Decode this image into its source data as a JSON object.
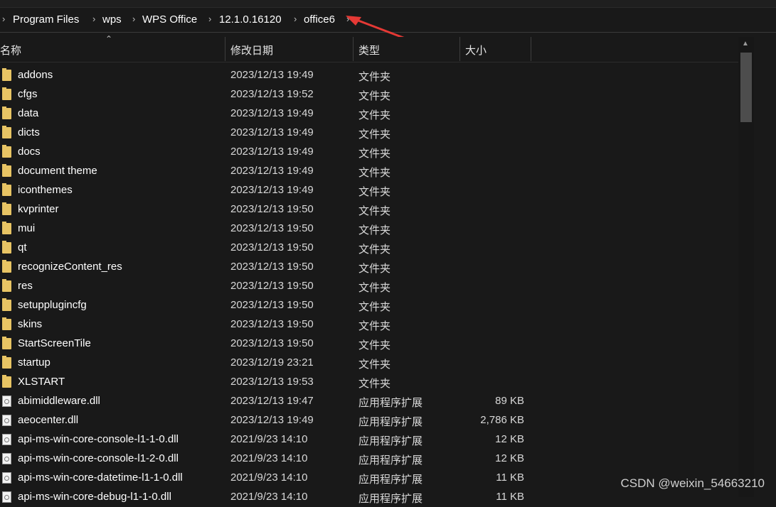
{
  "breadcrumb": [
    "Program Files",
    "wps",
    "WPS Office",
    "12.1.0.16120",
    "office6"
  ],
  "columns": {
    "name": "名称",
    "date": "修改日期",
    "type": "类型",
    "size": "大小"
  },
  "files": [
    {
      "name": "addons",
      "date": "2023/12/13 19:49",
      "type": "文件夹",
      "size": "",
      "kind": "folder"
    },
    {
      "name": "cfgs",
      "date": "2023/12/13 19:52",
      "type": "文件夹",
      "size": "",
      "kind": "folder"
    },
    {
      "name": "data",
      "date": "2023/12/13 19:49",
      "type": "文件夹",
      "size": "",
      "kind": "folder"
    },
    {
      "name": "dicts",
      "date": "2023/12/13 19:49",
      "type": "文件夹",
      "size": "",
      "kind": "folder"
    },
    {
      "name": "docs",
      "date": "2023/12/13 19:49",
      "type": "文件夹",
      "size": "",
      "kind": "folder"
    },
    {
      "name": "document theme",
      "date": "2023/12/13 19:49",
      "type": "文件夹",
      "size": "",
      "kind": "folder"
    },
    {
      "name": "iconthemes",
      "date": "2023/12/13 19:49",
      "type": "文件夹",
      "size": "",
      "kind": "folder"
    },
    {
      "name": "kvprinter",
      "date": "2023/12/13 19:50",
      "type": "文件夹",
      "size": "",
      "kind": "folder"
    },
    {
      "name": "mui",
      "date": "2023/12/13 19:50",
      "type": "文件夹",
      "size": "",
      "kind": "folder"
    },
    {
      "name": "qt",
      "date": "2023/12/13 19:50",
      "type": "文件夹",
      "size": "",
      "kind": "folder"
    },
    {
      "name": "recognizeContent_res",
      "date": "2023/12/13 19:50",
      "type": "文件夹",
      "size": "",
      "kind": "folder"
    },
    {
      "name": "res",
      "date": "2023/12/13 19:50",
      "type": "文件夹",
      "size": "",
      "kind": "folder"
    },
    {
      "name": "setupplugincfg",
      "date": "2023/12/13 19:50",
      "type": "文件夹",
      "size": "",
      "kind": "folder"
    },
    {
      "name": "skins",
      "date": "2023/12/13 19:50",
      "type": "文件夹",
      "size": "",
      "kind": "folder"
    },
    {
      "name": "StartScreenTile",
      "date": "2023/12/13 19:50",
      "type": "文件夹",
      "size": "",
      "kind": "folder"
    },
    {
      "name": "startup",
      "date": "2023/12/19 23:21",
      "type": "文件夹",
      "size": "",
      "kind": "folder"
    },
    {
      "name": "XLSTART",
      "date": "2023/12/13 19:53",
      "type": "文件夹",
      "size": "",
      "kind": "folder"
    },
    {
      "name": "abimiddleware.dll",
      "date": "2023/12/13 19:47",
      "type": "应用程序扩展",
      "size": "89 KB",
      "kind": "file"
    },
    {
      "name": "aeocenter.dll",
      "date": "2023/12/13 19:49",
      "type": "应用程序扩展",
      "size": "2,786 KB",
      "kind": "file"
    },
    {
      "name": "api-ms-win-core-console-l1-1-0.dll",
      "date": "2021/9/23 14:10",
      "type": "应用程序扩展",
      "size": "12 KB",
      "kind": "file"
    },
    {
      "name": "api-ms-win-core-console-l1-2-0.dll",
      "date": "2021/9/23 14:10",
      "type": "应用程序扩展",
      "size": "12 KB",
      "kind": "file"
    },
    {
      "name": "api-ms-win-core-datetime-l1-1-0.dll",
      "date": "2021/9/23 14:10",
      "type": "应用程序扩展",
      "size": "11 KB",
      "kind": "file"
    },
    {
      "name": "api-ms-win-core-debug-l1-1-0.dll",
      "date": "2021/9/23 14:10",
      "type": "应用程序扩展",
      "size": "11 KB",
      "kind": "file"
    }
  ],
  "watermark": "CSDN @weixin_54663210",
  "colors": {
    "background": "#191919",
    "folder": "#e8c464",
    "arrow": "#e53935"
  }
}
